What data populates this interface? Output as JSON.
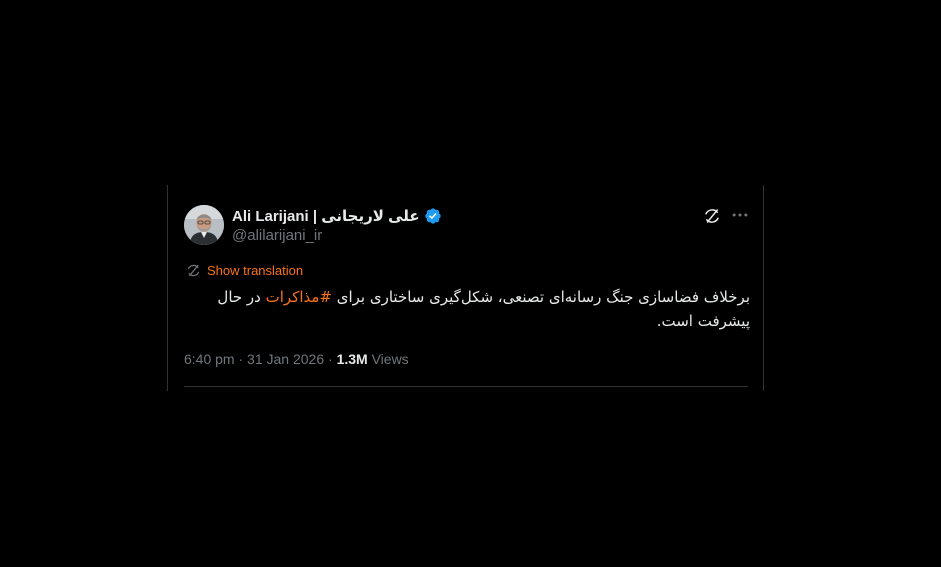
{
  "tweet": {
    "display_name": "Ali Larijani | علی لاریجانی",
    "handle": "@alilarijani_ir",
    "verified": true,
    "show_translation_label": "Show translation",
    "text_before_hashtag": "برخلاف فضاسازی جنگ رسانه‌ای تصنعی، شکل‌گیری ساختاری برای ",
    "hashtag": "#مذاکرات",
    "text_after_hashtag": " در حال پیشرفت است.",
    "time": "6:40 pm",
    "separator": "·",
    "date": "31 Jan 2026",
    "views_count": "1.3M",
    "views_label": "Views"
  },
  "icons": {
    "verified": "verified-badge-icon",
    "grok": "grok-icon",
    "more": "more-dots-icon",
    "translate": "translate-icon"
  },
  "colors": {
    "background": "#000000",
    "text": "#e7e9ea",
    "muted": "#71767b",
    "accent": "#f97316",
    "verified": "#1d9bf0",
    "border": "#2f3336"
  }
}
